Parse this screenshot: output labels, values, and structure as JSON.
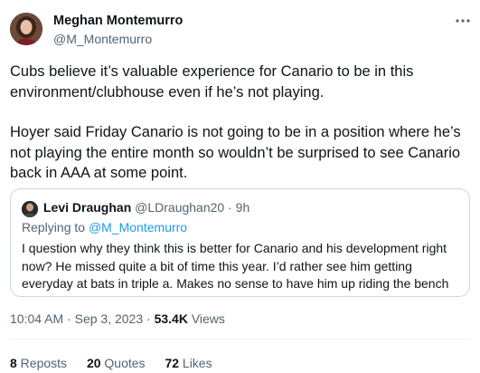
{
  "author": {
    "name": "Meghan Montemurro",
    "handle": "@M_Montemurro"
  },
  "tweet": {
    "paragraph1": "Cubs believe it’s valuable experience for Canario to be in this environment/clubhouse even if he’s not playing.",
    "paragraph2": "Hoyer said Friday Canario is not going to be in a position where he’s not playing the entire month so wouldn’t be surprised to see Canario back in AAA at some point."
  },
  "quote": {
    "name": "Levi Draughan",
    "handle": "@LDraughan20",
    "separator": " · ",
    "time": "9h",
    "replying_prefix": "Replying to ",
    "replying_to": "@M_Montemurro",
    "text": "I question why they think this is better for Canario and his development right now? He missed  quite a bit of time this year. I’d rather see him getting everyday at bats in triple a. Makes no sense to have him up riding the bench"
  },
  "meta": {
    "time": "10:04 AM",
    "sep1": " · ",
    "date": "Sep 3, 2023",
    "sep2": " · ",
    "views_count": "53.4K",
    "views_label": " Views"
  },
  "stats": {
    "reposts_count": "8",
    "reposts_label": " Reposts",
    "quotes_count": "20",
    "quotes_label": " Quotes",
    "likes_count": "72",
    "likes_label": " Likes"
  },
  "icons": {
    "more": "more-horizontal-icon"
  },
  "colors": {
    "text": "#0f1419",
    "secondary": "#536471",
    "link": "#1d9bf0",
    "border": "#cfd9de"
  }
}
